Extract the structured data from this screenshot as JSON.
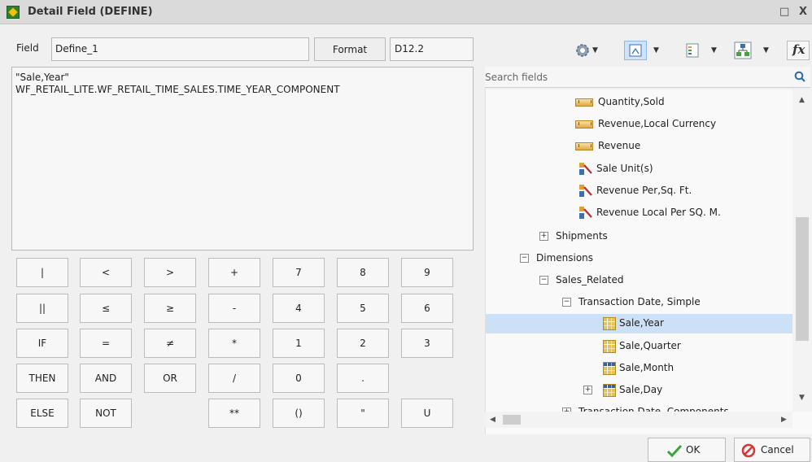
{
  "window": {
    "title": "Detail Field (DEFINE)",
    "maximize_glyph": "□",
    "close_glyph": "X"
  },
  "field": {
    "label": "Field",
    "value": "Define_1"
  },
  "format": {
    "button_label": "Format",
    "value": "D12.2"
  },
  "expression": [
    "\"Sale,Year\"",
    "WF_RETAIL_LITE.WF_RETAIL_TIME_SALES.TIME_YEAR_COMPONENT"
  ],
  "keypad": [
    [
      "|",
      "<",
      ">",
      "+",
      "7",
      "8",
      "9"
    ],
    [
      "||",
      "≤",
      "≥",
      "-",
      "4",
      "5",
      "6"
    ],
    [
      "IF",
      "=",
      "≠",
      "*",
      "1",
      "2",
      "3"
    ],
    [
      "THEN",
      "AND",
      "OR",
      "/",
      "0",
      "."
    ],
    [
      "ELSE",
      "NOT",
      "",
      "**",
      "()",
      "\"",
      "U"
    ]
  ],
  "toolbar": {
    "icons": [
      "gear-icon",
      "view-mode-icon",
      "list-view-icon",
      "logical-view-icon",
      "function-icon"
    ]
  },
  "search": {
    "placeholder": "Search fields"
  },
  "tree": [
    {
      "label": "Quantity,Sold",
      "icon": "measure"
    },
    {
      "label": "Revenue,Local Currency",
      "icon": "measure"
    },
    {
      "label": "Revenue",
      "icon": "measure"
    },
    {
      "label": "Sale Unit(s)",
      "icon": "compute"
    },
    {
      "label": "Revenue Per,Sq. Ft.",
      "icon": "compute"
    },
    {
      "label": "Revenue Local Per SQ. M.",
      "icon": "compute"
    },
    {
      "label": "Shipments",
      "expander": "+"
    },
    {
      "label": "Dimensions",
      "expander": "−"
    },
    {
      "label": "Sales_Related",
      "expander": "−"
    },
    {
      "label": "Transaction Date, Simple",
      "expander": "−"
    },
    {
      "label": "Sale,Year",
      "icon": "dim",
      "selected": true
    },
    {
      "label": "Sale,Quarter",
      "icon": "dim"
    },
    {
      "label": "Sale,Month",
      "icon": "dim-blue"
    },
    {
      "label": "Sale,Day",
      "icon": "dim-blue",
      "expander": "+"
    },
    {
      "label": "Transaction Date, Components",
      "expander": "+"
    }
  ],
  "footer": {
    "ok_label": "OK",
    "cancel_label": "Cancel"
  },
  "colors": {
    "selection": "#cce1f7",
    "ok_check": "#3aa53a",
    "cancel": "#d23a3a"
  }
}
